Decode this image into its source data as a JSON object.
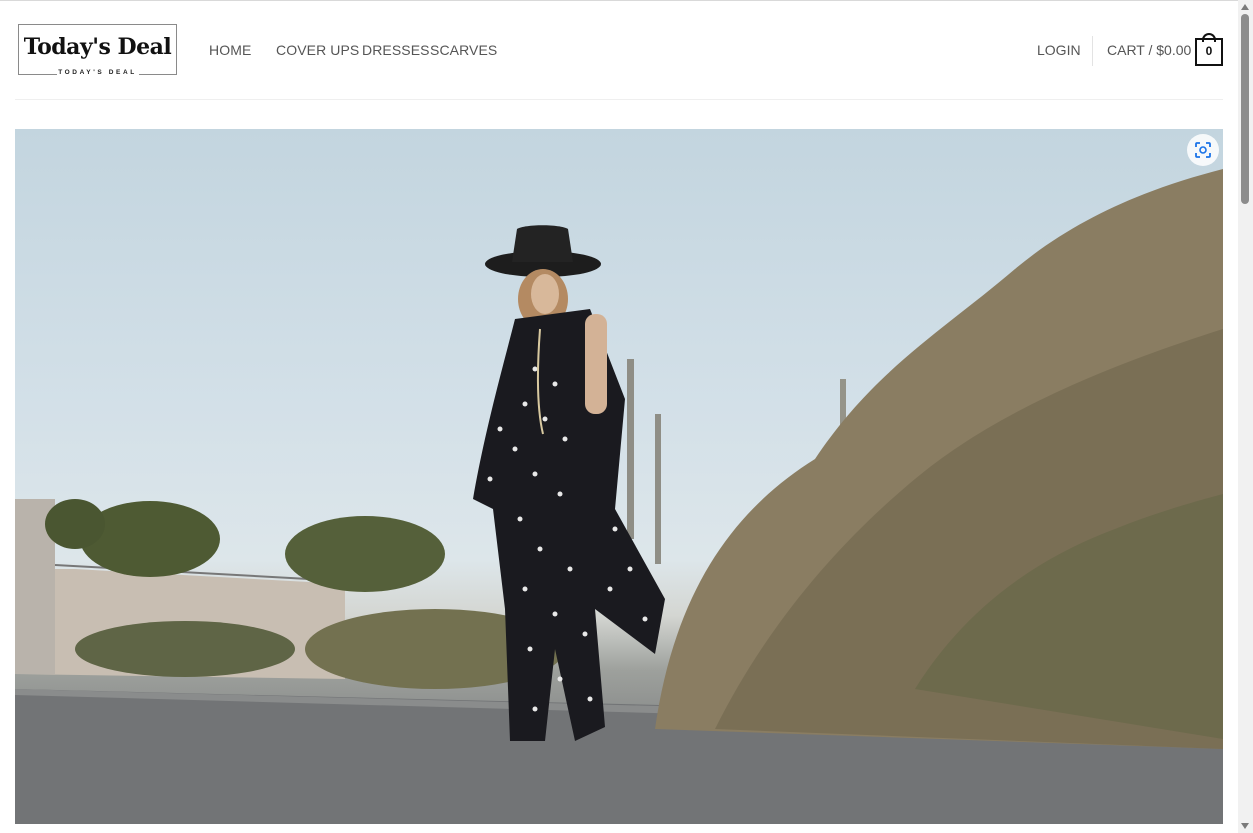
{
  "logo": {
    "title": "Today's Deal",
    "subtitle": "TODAY'S DEAL"
  },
  "nav": {
    "items": [
      {
        "label": "HOME"
      },
      {
        "label": "COVER UPS"
      },
      {
        "label": "DRESSES"
      },
      {
        "label": "SCARVES"
      }
    ]
  },
  "account": {
    "login_label": "LOGIN",
    "cart_label": "CART / $0.00",
    "cart_count": "0"
  },
  "hero": {
    "icon": "zoom-icon",
    "image_subject": "woman-in-polka-dot-outfit"
  },
  "colors": {
    "accent": "#1a73e8",
    "text": "#555555",
    "dark": "#111111"
  }
}
